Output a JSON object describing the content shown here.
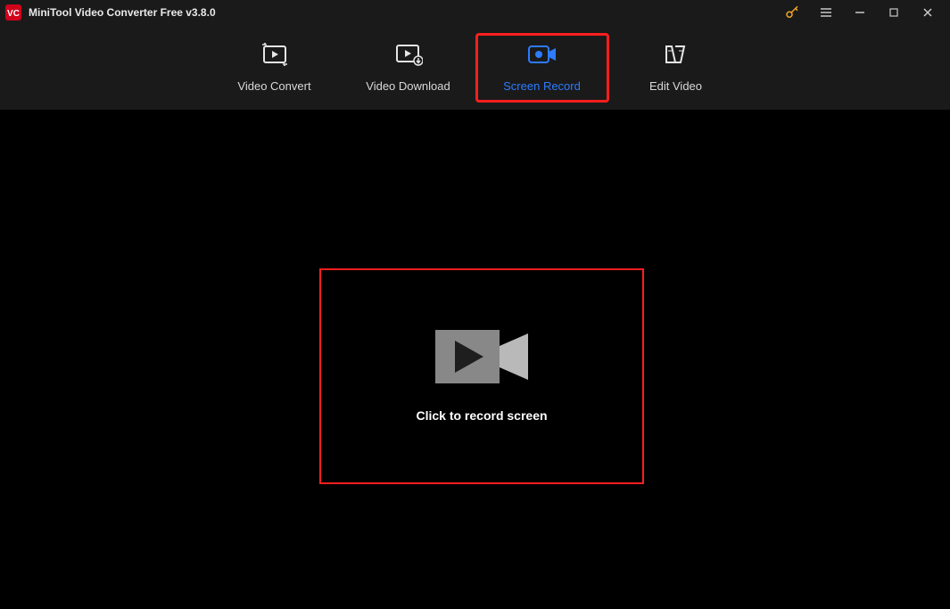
{
  "titlebar": {
    "title": "MiniTool Video Converter Free v3.8.0"
  },
  "tabs": {
    "convert": "Video Convert",
    "download": "Video Download",
    "record": "Screen Record",
    "edit": "Edit Video"
  },
  "main": {
    "record_caption": "Click to record screen"
  }
}
